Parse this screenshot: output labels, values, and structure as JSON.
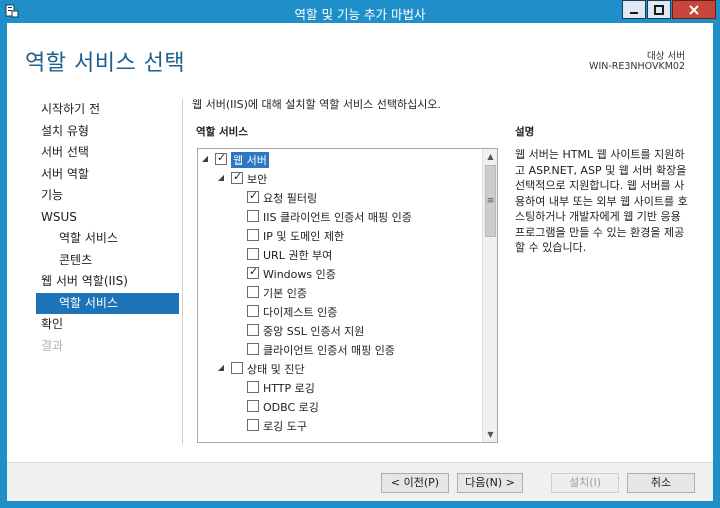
{
  "window": {
    "title": "역할 및 기능 추가 마법사",
    "controls": {
      "minimize_icon": "minimize-icon",
      "maximize_icon": "maximize-icon",
      "close_icon": "close-icon"
    }
  },
  "header": {
    "page_title": "역할 서비스 선택",
    "dest_label": "대상 서버",
    "dest_value": "WIN-RE3NHOVKM02"
  },
  "nav": {
    "items": [
      {
        "label": "시작하기 전",
        "level": 0,
        "state": "normal"
      },
      {
        "label": "설치 유형",
        "level": 0,
        "state": "normal"
      },
      {
        "label": "서버 선택",
        "level": 0,
        "state": "normal"
      },
      {
        "label": "서버 역할",
        "level": 0,
        "state": "normal"
      },
      {
        "label": "기능",
        "level": 0,
        "state": "normal"
      },
      {
        "label": "WSUS",
        "level": 0,
        "state": "normal"
      },
      {
        "label": "역할 서비스",
        "level": 1,
        "state": "normal"
      },
      {
        "label": "콘텐츠",
        "level": 1,
        "state": "normal"
      },
      {
        "label": "웹 서버 역할(IIS)",
        "level": 0,
        "state": "normal"
      },
      {
        "label": "역할 서비스",
        "level": 1,
        "state": "active"
      },
      {
        "label": "확인",
        "level": 0,
        "state": "normal"
      },
      {
        "label": "결과",
        "level": 0,
        "state": "disabled"
      }
    ]
  },
  "main": {
    "intro": "웹 서버(IIS)에 대해 설치할 역할 서비스 선택하십시오.",
    "roles_header": "역할 서비스",
    "tree": [
      {
        "label": "웹 서버",
        "level": 0,
        "expander": "◢",
        "checked": true,
        "selected": true
      },
      {
        "label": "보안",
        "level": 1,
        "expander": "◢",
        "checked": true,
        "selected": false
      },
      {
        "label": "요청 필터링",
        "level": 2,
        "expander": "",
        "checked": true,
        "selected": false
      },
      {
        "label": "IIS 클라이언트 인증서 매핑 인증",
        "level": 2,
        "expander": "",
        "checked": false,
        "selected": false
      },
      {
        "label": "IP 및 도메인 제한",
        "level": 2,
        "expander": "",
        "checked": false,
        "selected": false
      },
      {
        "label": "URL 권한 부여",
        "level": 2,
        "expander": "",
        "checked": false,
        "selected": false
      },
      {
        "label": "Windows 인증",
        "level": 2,
        "expander": "",
        "checked": true,
        "selected": false
      },
      {
        "label": "기본 인증",
        "level": 2,
        "expander": "",
        "checked": false,
        "selected": false
      },
      {
        "label": "다이제스트 인증",
        "level": 2,
        "expander": "",
        "checked": false,
        "selected": false
      },
      {
        "label": "중앙 SSL 인증서 지원",
        "level": 2,
        "expander": "",
        "checked": false,
        "selected": false
      },
      {
        "label": "클라이언트 인증서 매핑 인증",
        "level": 2,
        "expander": "",
        "checked": false,
        "selected": false
      },
      {
        "label": "상태 및 진단",
        "level": 1,
        "expander": "◢",
        "checked": false,
        "selected": false
      },
      {
        "label": "HTTP 로깅",
        "level": 2,
        "expander": "",
        "checked": false,
        "selected": false
      },
      {
        "label": "ODBC 로깅",
        "level": 2,
        "expander": "",
        "checked": false,
        "selected": false
      },
      {
        "label": "로깅 도구",
        "level": 2,
        "expander": "",
        "checked": false,
        "selected": false
      }
    ],
    "check_glyph": "✓",
    "scroll_up_glyph": "▲",
    "scroll_down_glyph": "▼",
    "scroll_grip_glyph": "≡"
  },
  "description": {
    "header": "설명",
    "text": "웹 서버는 HTML 웹 사이트를 지원하고 ASP.NET, ASP 및 웹 서버 확장을 선택적으로 지원합니다. 웹 서버를 사용하여 내부 또는 외부 웹 사이트를 호스팅하거나 개발자에게 웹 기반 응용 프로그램을 만들 수 있는 환경을 제공할 수 있습니다."
  },
  "footer": {
    "prev": "< 이전(P)",
    "next": "다음(N) >",
    "install": "설치(I)",
    "cancel": "취소"
  }
}
